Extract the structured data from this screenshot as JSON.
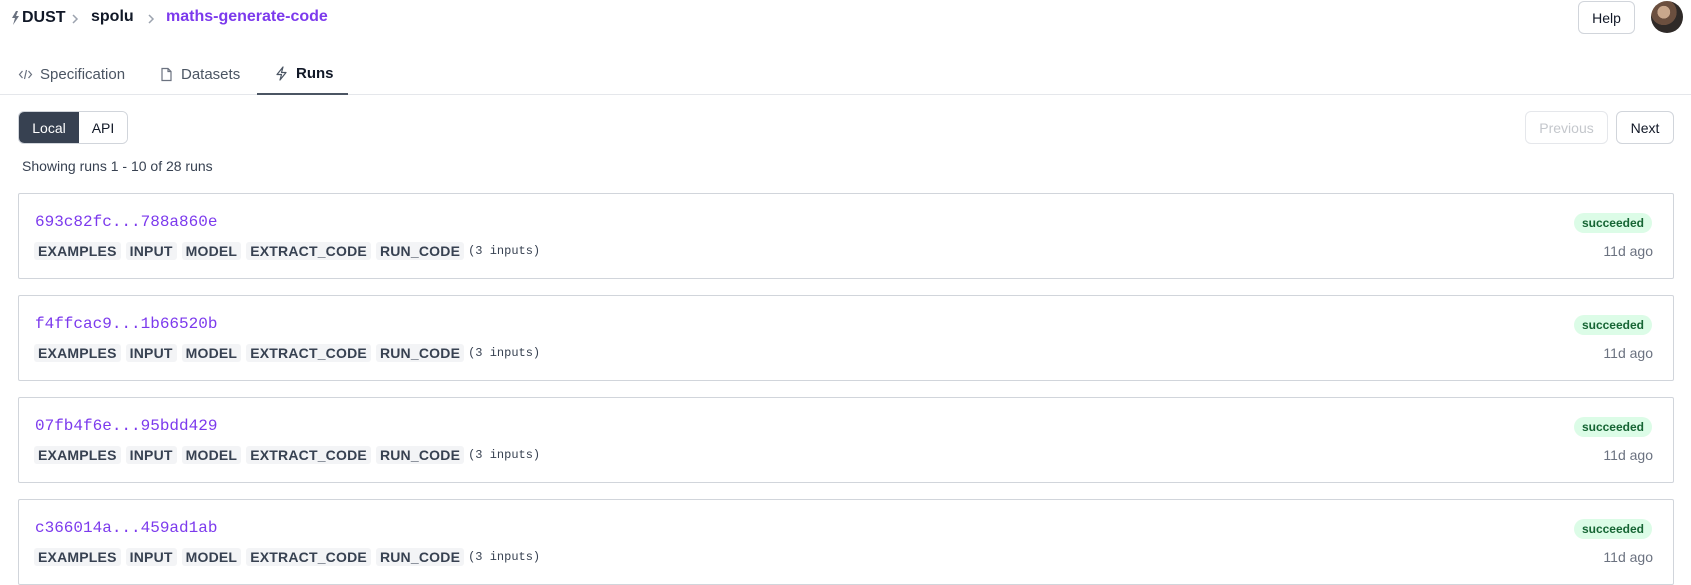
{
  "header": {
    "logo_text": "DUST",
    "breadcrumb_user": "spolu",
    "breadcrumb_app": "maths-generate-code",
    "help_label": "Help"
  },
  "tabs": [
    {
      "label": "Specification",
      "icon": "code-icon"
    },
    {
      "label": "Datasets",
      "icon": "document-icon"
    },
    {
      "label": "Runs",
      "icon": "bolt-icon",
      "active": true
    }
  ],
  "toggle": {
    "local": "Local",
    "api": "API",
    "selected": "Local"
  },
  "pager": {
    "previous": "Previous",
    "next": "Next"
  },
  "summary": "Showing runs 1 - 10 of 28 runs",
  "runs": [
    {
      "id": "693c82fc...788a860e",
      "blocks": [
        "EXAMPLES",
        "INPUT",
        "MODEL",
        "EXTRACT_CODE",
        "RUN_CODE"
      ],
      "inputs": "(3 inputs)",
      "status": "succeeded",
      "ago": "11d ago"
    },
    {
      "id": "f4ffcac9...1b66520b",
      "blocks": [
        "EXAMPLES",
        "INPUT",
        "MODEL",
        "EXTRACT_CODE",
        "RUN_CODE"
      ],
      "inputs": "(3 inputs)",
      "status": "succeeded",
      "ago": "11d ago"
    },
    {
      "id": "07fb4f6e...95bdd429",
      "blocks": [
        "EXAMPLES",
        "INPUT",
        "MODEL",
        "EXTRACT_CODE",
        "RUN_CODE"
      ],
      "inputs": "(3 inputs)",
      "status": "succeeded",
      "ago": "11d ago"
    },
    {
      "id": "c366014a...459ad1ab",
      "blocks": [
        "EXAMPLES",
        "INPUT",
        "MODEL",
        "EXTRACT_CODE",
        "RUN_CODE"
      ],
      "inputs": "(3 inputs)",
      "status": "succeeded",
      "ago": "11d ago"
    }
  ],
  "colors": {
    "accent": "#7c3aed",
    "success_bg": "#dcfce7",
    "success_text": "#166534",
    "toggle_active": "#374151"
  }
}
